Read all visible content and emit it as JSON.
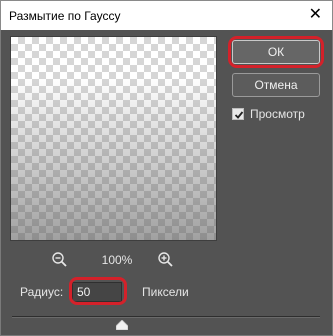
{
  "window": {
    "title": "Размытие по Гауссу",
    "close_glyph": "✕"
  },
  "preview": {
    "zoom_level": "100%"
  },
  "buttons": {
    "ok_label": "ОК",
    "cancel_label": "Отмена"
  },
  "preview_toggle": {
    "label": "Просмотр",
    "checked": true
  },
  "radius": {
    "label": "Радиус:",
    "value": "50",
    "unit": "Пиксели"
  },
  "icons": {
    "zoom_out": "zoom-out-icon",
    "zoom_in": "zoom-in-icon",
    "close": "close-icon",
    "check": "check-icon",
    "slider_thumb": "slider-thumb-icon"
  },
  "colors": {
    "highlight": "#d4212a",
    "panel": "#535353"
  }
}
